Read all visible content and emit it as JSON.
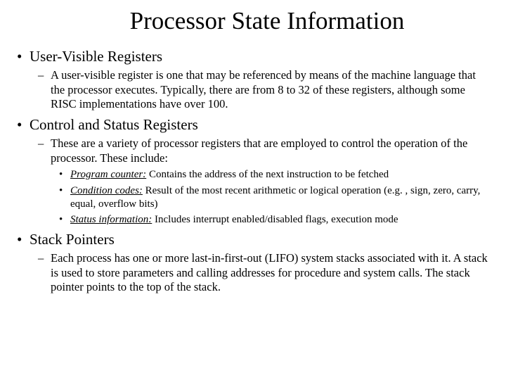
{
  "title": "Processor State Information",
  "sections": [
    {
      "heading": "User-Visible Registers",
      "subs": [
        {
          "text": "A user-visible register is one that may be referenced by means of the machine language that the processor executes. Typically, there are from 8 to 32 of these registers, although some RISC implementations have over 100."
        }
      ]
    },
    {
      "heading": "Control and Status Registers",
      "subs": [
        {
          "text": "These are a variety of processor registers that are employed to control the operation of the processor. These include:",
          "items": [
            {
              "label": "Program counter:",
              "desc": " Contains the address of the next instruction to be fetched"
            },
            {
              "label": "Condition codes:",
              "desc": " Result of the most recent arithmetic or logical operation (e.g. , sign, zero, carry, equal, overflow bits)"
            },
            {
              "label": "Status information:",
              "desc": " Includes interrupt enabled/disabled flags, execution mode"
            }
          ]
        }
      ]
    },
    {
      "heading": "Stack Pointers",
      "subs": [
        {
          "text": "Each process has one or more last-in-first-out (LIFO) system stacks associated with it. A stack is used to store parameters and calling addresses for procedure and system calls. The stack pointer points to the top of the stack."
        }
      ]
    }
  ]
}
